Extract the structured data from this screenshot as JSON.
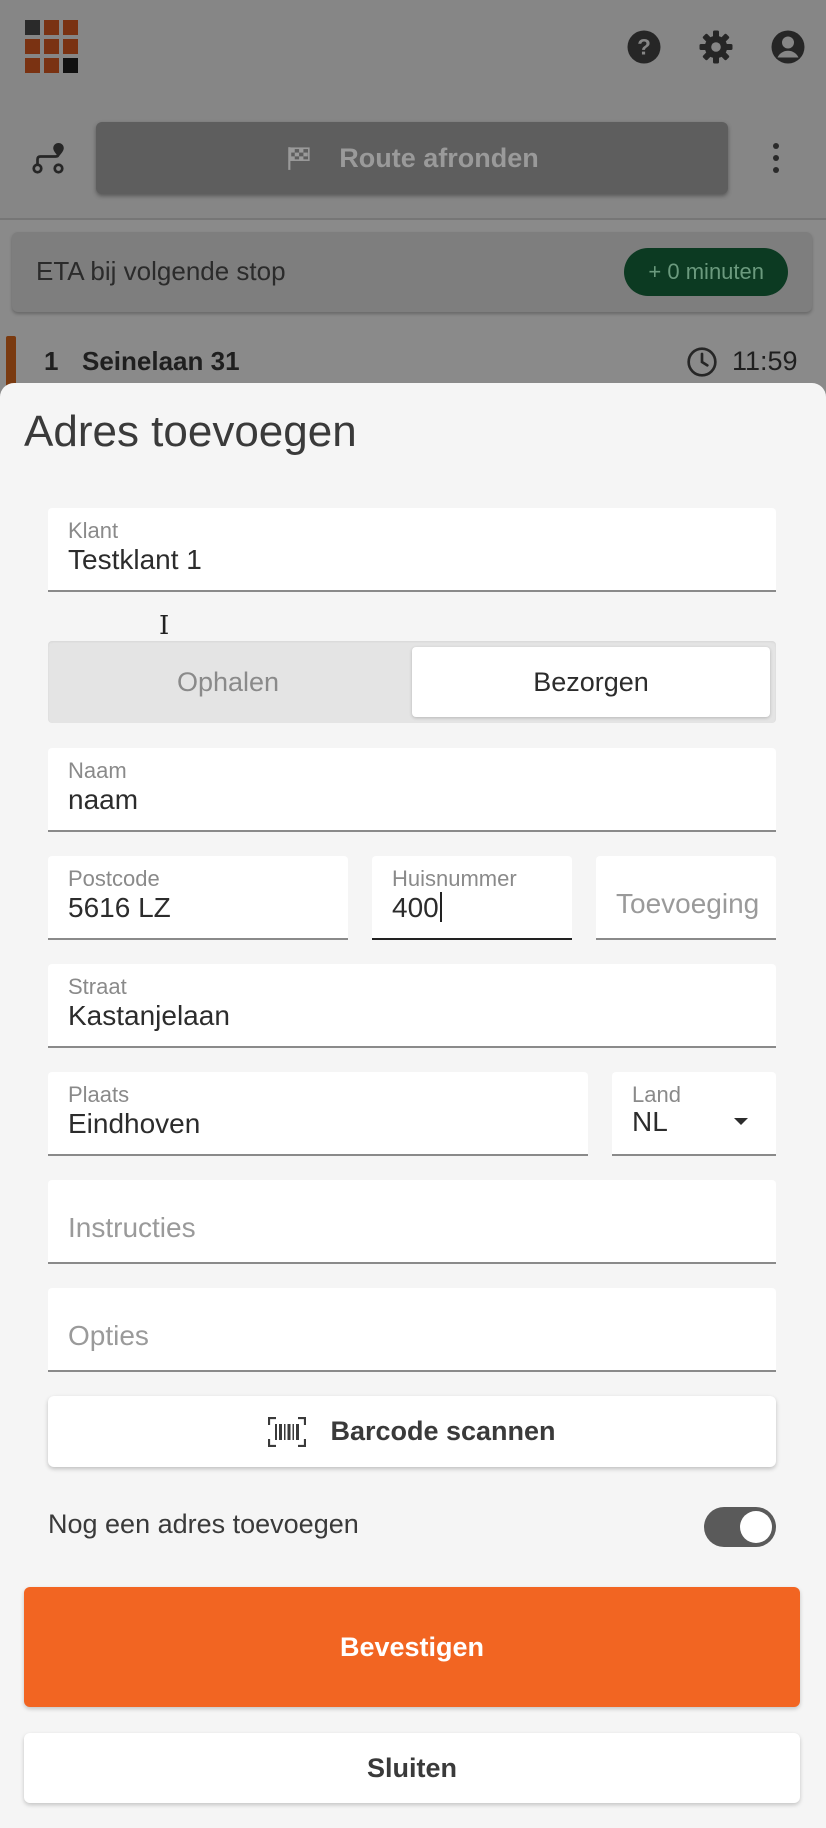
{
  "header": {
    "logo_icon": "grid-logo-icon",
    "icons": [
      "help-icon",
      "settings-icon",
      "account-icon"
    ]
  },
  "toolbar": {
    "route_icon": "route-icon",
    "finish_route_label": "Route afronden",
    "finish_icon": "checkered-flag-icon",
    "menu_icon": "more-vertical-icon"
  },
  "eta": {
    "label": "ETA bij volgende stop",
    "delay": "+ 0 minuten"
  },
  "stop": {
    "number": "1",
    "name": "Seinelaan 31",
    "time": "11:59"
  },
  "sheet": {
    "title": "Adres toevoegen",
    "customer": {
      "label": "Klant",
      "value": "Testklant 1"
    },
    "type_toggle": {
      "options": [
        "Ophalen",
        "Bezorgen"
      ],
      "selected": "Bezorgen"
    },
    "name": {
      "label": "Naam",
      "value": "naam"
    },
    "postcode": {
      "label": "Postcode",
      "value": "5616 LZ"
    },
    "house_number": {
      "label": "Huisnummer",
      "value": "400"
    },
    "addition": {
      "placeholder": "Toevoeging"
    },
    "street": {
      "label": "Straat",
      "value": "Kastanjelaan"
    },
    "city": {
      "label": "Plaats",
      "value": "Eindhoven"
    },
    "country": {
      "label": "Land",
      "value": "NL"
    },
    "instructions": {
      "placeholder": "Instructies"
    },
    "options": {
      "placeholder": "Opties"
    },
    "barcode_button": "Barcode scannen",
    "add_another_label": "Nog een adres toevoegen",
    "add_another_on": true,
    "confirm_button": "Bevestigen",
    "close_button": "Sluiten"
  },
  "colors": {
    "accent": "#f26522",
    "eta_chip": "#0c3a22",
    "stop_marker": "#7a3a10"
  }
}
